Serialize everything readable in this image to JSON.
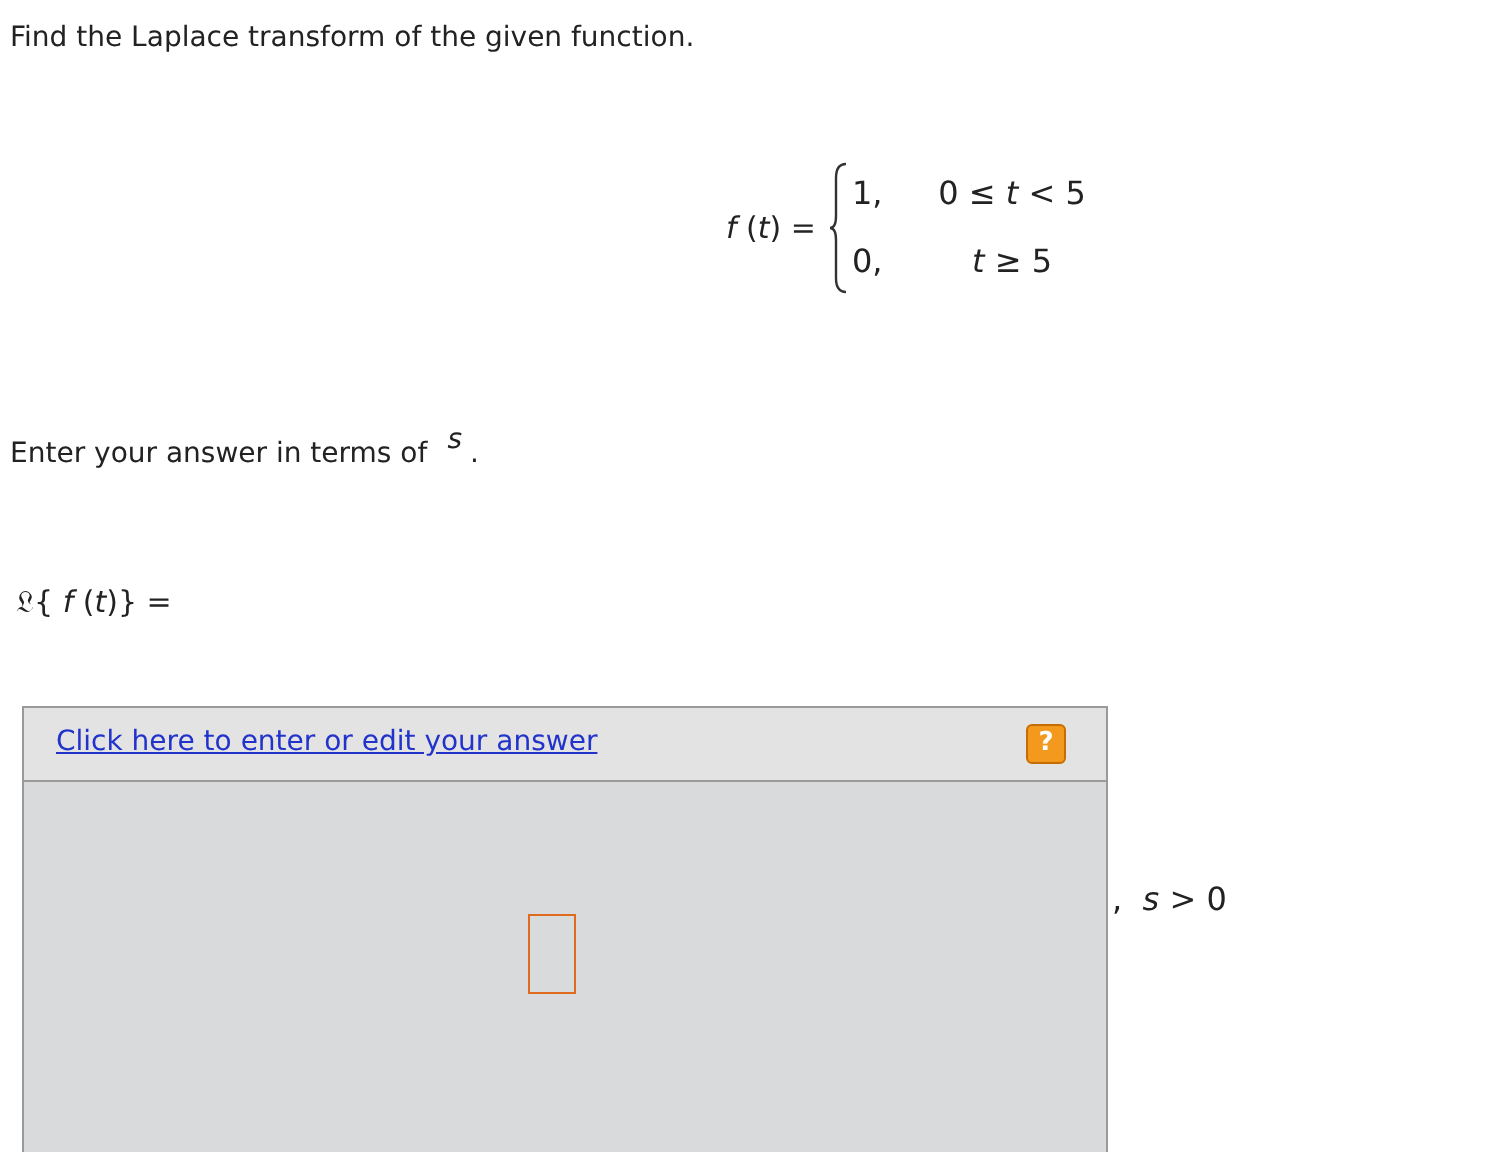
{
  "instruction": "Find the Laplace transform of the given function.",
  "function": {
    "lhs": "*f* (*t*) =",
    "cases": [
      {
        "value": "1,",
        "condition": "0 ≤ *t* < 5"
      },
      {
        "value": "0,",
        "condition": "*t* ≥ 5"
      }
    ]
  },
  "variable_prompt": {
    "text": "Enter your answer in terms of",
    "variable": "*s*",
    "end": "."
  },
  "transform_label": "𝔏{ *f* (*t*)} =",
  "answer_editor": {
    "link": "Click here to enter or edit your answer",
    "help": "?"
  },
  "condition_suffix": ",  *s* > 0"
}
